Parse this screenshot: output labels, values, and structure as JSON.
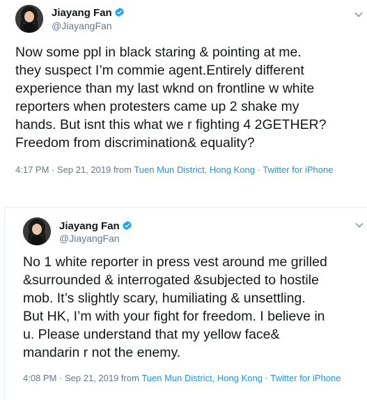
{
  "tweets": [
    {
      "author": {
        "name": "Jiayang Fan",
        "handle": "@JiayangFan"
      },
      "lines": [
        "Now some ppl in black staring & pointing at me.",
        "they suspect I’m commie agent.Entirely different",
        "experience than my last wknd on frontline w white",
        "reporters when protesters came up 2 shake my",
        "hands. But isnt this what we r fighting 4 2GETHER?",
        "Freedom from discrimination& equality?"
      ],
      "time": "4:17 PM · Sep 21, 2019 from ",
      "location": "Tuen Mun District, Hong Kong",
      "sep": " · ",
      "source": "Twitter for iPhone"
    },
    {
      "author": {
        "name": "Jiayang Fan",
        "handle": "@JiayangFan"
      },
      "lines": [
        "No 1 white reporter in press vest around me grilled",
        "&surrounded & interrogated &subjected to hostile",
        "mob. It’s slightly scary, humiliating & unsettling.",
        "But HK, I’m with your fight for freedom. I believe in",
        "u. Please understand that my yellow face&",
        "mandarin r not the enemy."
      ],
      "time": "4:08 PM · Sep 21, 2019 from ",
      "location": "Tuen Mun District, Hong Kong",
      "sep": " · ",
      "source": "Twitter for iPhone"
    }
  ],
  "icons": {
    "verified": "verified-badge-icon",
    "caret": "chevron-down-icon"
  },
  "colors": {
    "link": "#1b95e0",
    "verified": "#1da1f2",
    "muted": "#657786"
  }
}
